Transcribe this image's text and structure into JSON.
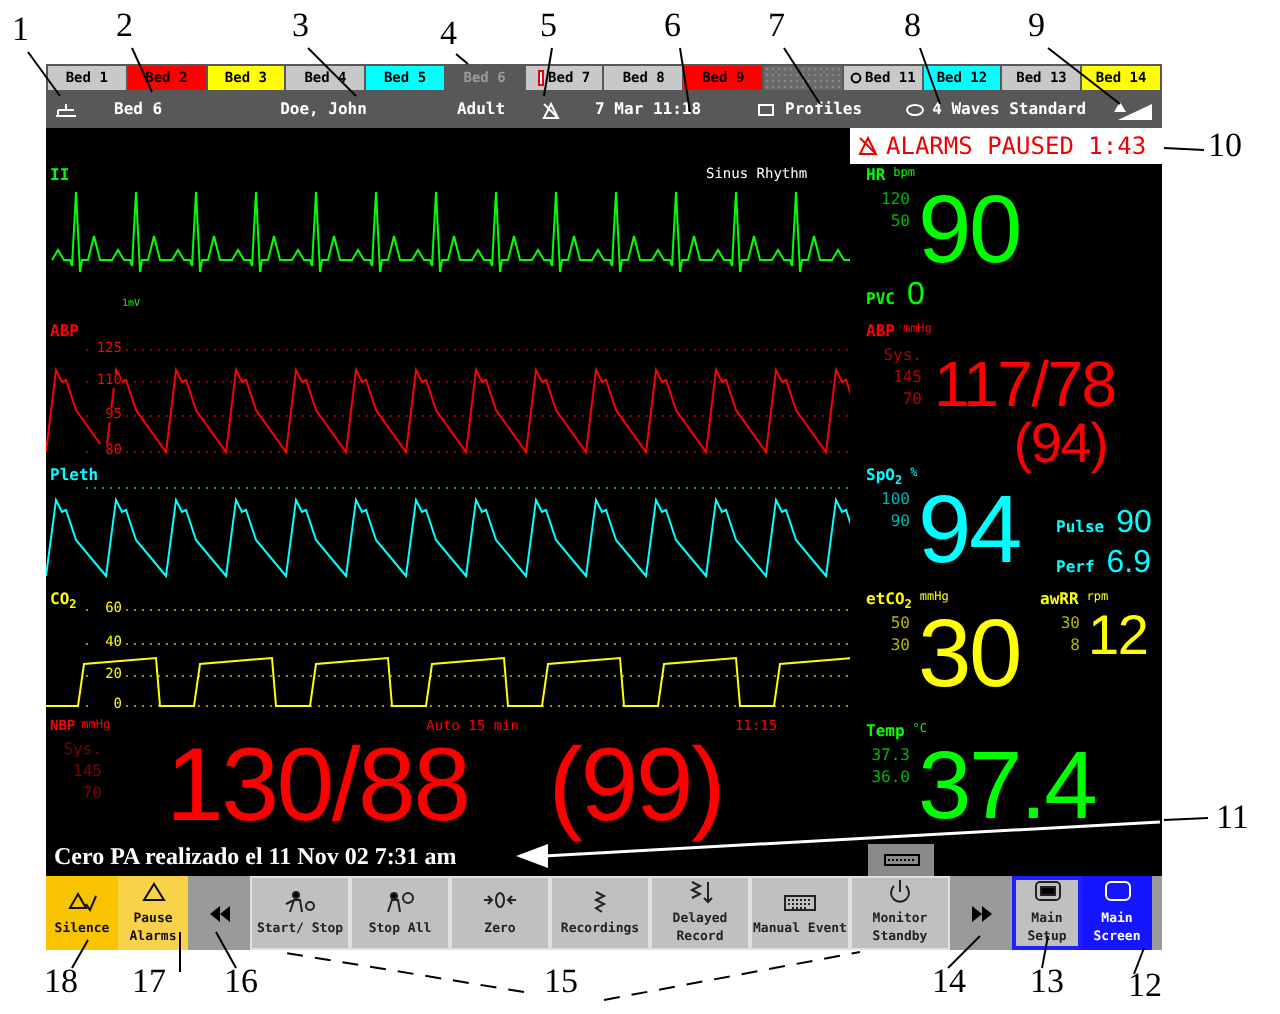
{
  "callouts": [
    "1",
    "2",
    "3",
    "4",
    "5",
    "6",
    "7",
    "8",
    "9",
    "10",
    "11",
    "18",
    "17",
    "16",
    "15",
    "14",
    "13",
    "12"
  ],
  "beds": [
    {
      "label": "Bed 1",
      "kind": "bed",
      "color": "#c8c8c8"
    },
    {
      "label": "Bed 2",
      "kind": "bed",
      "color": "#ff0000"
    },
    {
      "label": "Bed 3",
      "kind": "bed",
      "color": "#ffff00"
    },
    {
      "label": "Bed 4",
      "kind": "bed",
      "color": "#c8c8c8"
    },
    {
      "label": "Bed 5",
      "kind": "bed",
      "color": "#00ffff"
    },
    {
      "label": "Bed 6",
      "kind": "own"
    },
    {
      "label": "Bed 7",
      "kind": "flagged",
      "color": "#c8c8c8"
    },
    {
      "label": "Bed 8",
      "kind": "bed",
      "color": "#c8c8c8"
    },
    {
      "label": "Bed 9",
      "kind": "bed",
      "color": "#ff0000"
    },
    {
      "kind": "empty"
    },
    {
      "label": "Bed 11",
      "kind": "linked",
      "color": "#c8c8c8"
    },
    {
      "label": "Bed 12",
      "kind": "bed",
      "color": "#00ffff"
    },
    {
      "label": "Bed 13",
      "kind": "bed",
      "color": "#c8c8c8"
    },
    {
      "label": "Bed 14",
      "kind": "bed",
      "color": "#ffff00"
    }
  ],
  "header": {
    "bed": "Bed 6",
    "patient": "Doe, John",
    "category": "Adult",
    "datetime": "7 Mar 11:18",
    "profiles": "Profiles",
    "profile_name": "4 Waves Standard"
  },
  "alarm": {
    "text": "ALARMS PAUSED 1:43"
  },
  "rows": [
    {
      "wave": {
        "kind": "ecg",
        "label": "II",
        "color": "#00ff00",
        "note": "Sinus Rhythm",
        "calibration": "1mV"
      },
      "params": [
        {
          "kind": "big",
          "label": "HR",
          "unit": "bpm",
          "limits": [
            "120",
            "50"
          ],
          "value": "90",
          "color": "#00ff00"
        },
        {
          "kind": "small",
          "label": "PVC",
          "value": "0",
          "color": "#00ff00"
        }
      ]
    },
    {
      "wave": {
        "kind": "abp",
        "label": "ABP",
        "color": "#ff0000",
        "scale": [
          "125",
          "110",
          "95",
          "80"
        ]
      },
      "params": [
        {
          "kind": "bp",
          "label": "ABP",
          "unit": "mmHg",
          "source": "Sys.",
          "limits": [
            "145",
            "70"
          ],
          "value": "117/78",
          "mean": "(94)",
          "color": "#ff0000"
        }
      ]
    },
    {
      "wave": {
        "kind": "pleth",
        "label": "Pleth",
        "color": "#00ffff"
      },
      "params": [
        {
          "kind": "big",
          "label": "SpO$_{2}$",
          "unit": "%",
          "limits": [
            "100",
            "90"
          ],
          "value": "94",
          "color": "#00ffff"
        },
        {
          "kind": "side",
          "label": "Pulse",
          "value": "90",
          "color": "#00ffff"
        },
        {
          "kind": "side",
          "label": "Perf",
          "value": "6.9",
          "color": "#00ffff"
        }
      ]
    },
    {
      "wave": {
        "kind": "co2",
        "label": "CO$_{2}$",
        "color": "#ffff00",
        "scale": [
          "60",
          "40",
          "20",
          "0"
        ]
      },
      "params": [
        {
          "kind": "big",
          "label": "etCO$_{2}$",
          "unit": "mmHg",
          "limits": [
            "50",
            "30"
          ],
          "value": "30",
          "color": "#ffff00"
        },
        {
          "kind": "mid",
          "label": "awRR",
          "unit": "rpm",
          "limits": [
            "30",
            "8"
          ],
          "value": "12",
          "color": "#ffff00"
        }
      ]
    },
    {
      "nbp": {
        "label": "NBP",
        "unit": "mmHg",
        "source": "Sys.",
        "limits": [
          "145",
          "70"
        ],
        "mode": "Auto 15 min",
        "time": "11:15",
        "value": "130/88",
        "mean": "(99)",
        "color": "#ff0000"
      },
      "params": [
        {
          "kind": "big",
          "label": "Temp",
          "unit": "°C",
          "limits": [
            "37.3",
            "36.0"
          ],
          "value": "37.4",
          "color": "#00ff00"
        }
      ]
    }
  ],
  "message": "Cero PA realizado el 11 Nov 02 7:31 am",
  "buttons": [
    {
      "kind": "silence",
      "label": "Silence",
      "selected": false
    },
    {
      "kind": "pause",
      "label": "Pause Alarms",
      "selected": false
    },
    {
      "kind": "prev",
      "selected": false
    },
    {
      "kind": "start",
      "label": "Start/ Stop",
      "selected": false
    },
    {
      "kind": "stopall",
      "label": "Stop All",
      "selected": false
    },
    {
      "kind": "zero",
      "label": "Zero",
      "selected": false
    },
    {
      "kind": "recordings",
      "label": "Recordings",
      "selected": false
    },
    {
      "kind": "delayed",
      "label": "Delayed Record",
      "selected": false
    },
    {
      "kind": "event",
      "label": "Manual Event",
      "selected": false
    },
    {
      "kind": "standby",
      "label": "Monitor Standby",
      "selected": false
    },
    {
      "kind": "next",
      "selected": false
    },
    {
      "kind": "setup",
      "label": "Main Setup",
      "selected": false
    },
    {
      "kind": "screen",
      "label": "Main Screen",
      "selected": true
    }
  ]
}
